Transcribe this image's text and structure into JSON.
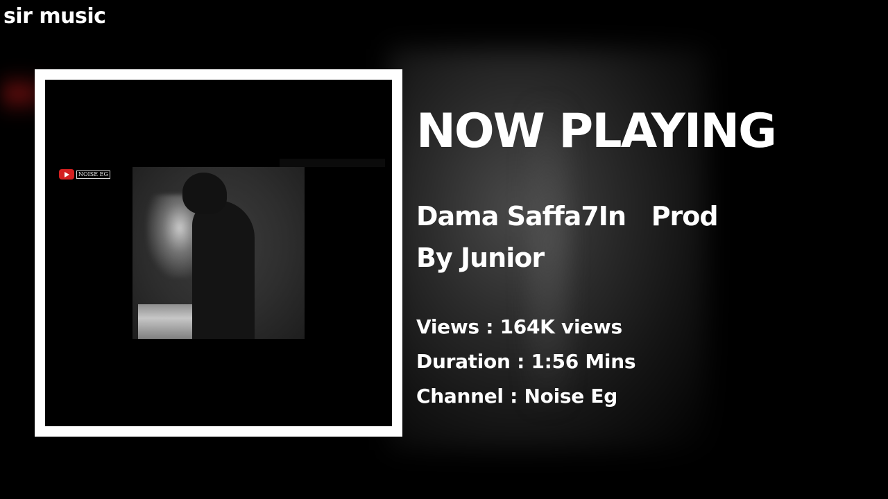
{
  "app": {
    "brand": "sir music"
  },
  "now_playing": {
    "heading": "NOW PLAYING",
    "track_title": "Dama Saffa7In   Prod By Junior",
    "views_label": "Views : ",
    "views_value": "164K views",
    "duration_label": "Duration : ",
    "duration_value": "1:56 Mins",
    "channel_label": "Channel : ",
    "channel_value": "Noise Eg"
  },
  "cover": {
    "channel_tag": "NOISE EG",
    "icons": [
      "youtube-play-icon"
    ]
  },
  "colors": {
    "background": "#000000",
    "frame": "#ffffff",
    "text": "#ffffff",
    "youtube_red": "#d42020"
  }
}
